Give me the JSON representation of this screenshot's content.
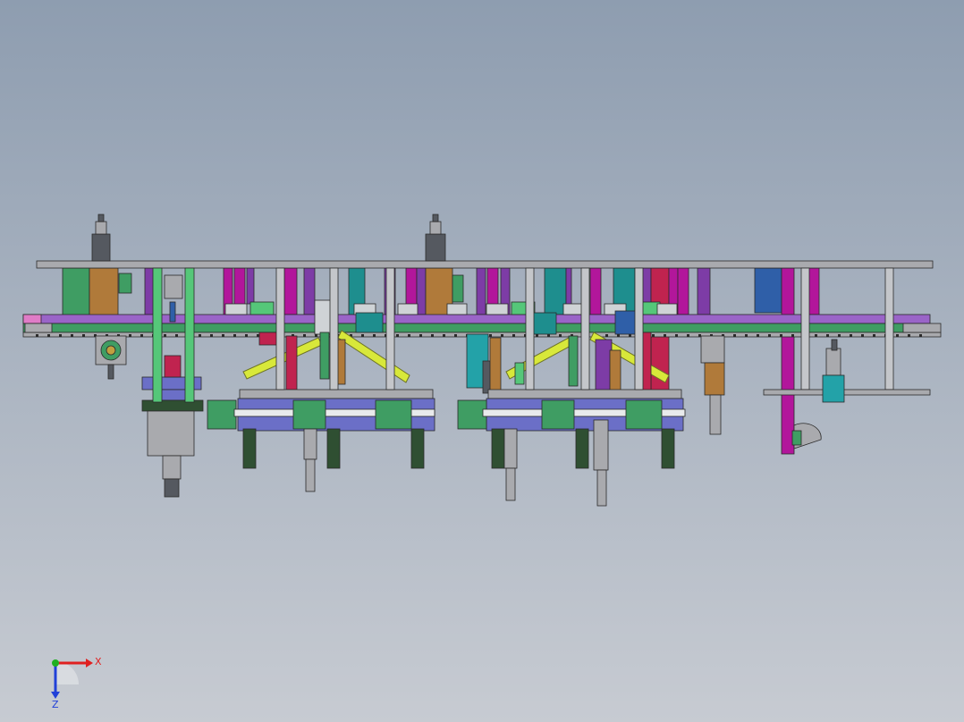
{
  "viewport": {
    "background_top": "#8e9db0",
    "background_bottom": "#c7cbd2"
  },
  "colors": {
    "frame_gray": "#a9aaae",
    "outline": "#2a2a2a",
    "green": "#3f9d63",
    "light_green": "#55c779",
    "magenta": "#b2169b",
    "purple": "#7d3ca6",
    "teal": "#1e8e8e",
    "cyan": "#23a2a8",
    "brown": "#b07a3a",
    "yellow": "#d8e83a",
    "red": "#c0234f",
    "blue": "#2f5fa8",
    "dark_green": "#2f4f32",
    "slate_blue": "#6b6fc7",
    "dark_gray": "#555960",
    "orange": "#e07820",
    "pink": "#e07cc7"
  },
  "triad": {
    "x_label": "X",
    "z_label": "Z",
    "x_color": "#e02020",
    "z_color": "#2040d8",
    "y_color": "#20b020"
  }
}
